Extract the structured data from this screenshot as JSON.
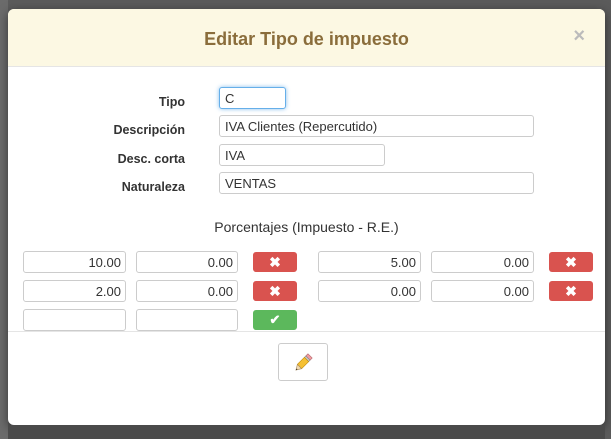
{
  "dialog": {
    "title": "Editar Tipo de impuesto",
    "close_symbol": "×"
  },
  "form": {
    "tipo_label": "Tipo",
    "tipo_value": "C",
    "descripcion_label": "Descripción",
    "descripcion_value": "IVA Clientes (Repercutido)",
    "desc_corta_label": "Desc. corta",
    "desc_corta_value": "IVA",
    "naturaleza_label": "Naturaleza",
    "naturaleza_value": "VENTAS"
  },
  "percentages": {
    "title": "Porcentajes (Impuesto - R.E.)",
    "rows": [
      {
        "impuesto": "10.00",
        "re": "0.00"
      },
      {
        "impuesto": "5.00",
        "re": "0.00"
      },
      {
        "impuesto": "2.00",
        "re": "0.00"
      },
      {
        "impuesto": "0.00",
        "re": "0.00"
      }
    ],
    "new_row": {
      "impuesto": "",
      "re": ""
    },
    "delete_symbol": "✖",
    "confirm_symbol": "✔"
  },
  "icons": {
    "close": "close-icon",
    "delete": "times-icon",
    "confirm": "check-icon",
    "edit": "pencil-icon"
  },
  "colors": {
    "header_bg": "#fcf8e3",
    "title_color": "#8a6d3b",
    "danger": "#d9534f",
    "success": "#5cb85c"
  }
}
